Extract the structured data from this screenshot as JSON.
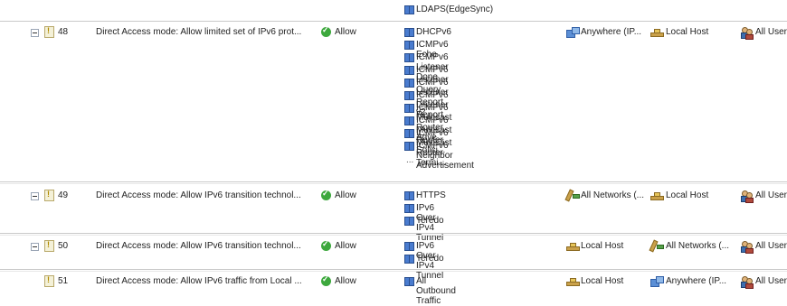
{
  "top_partial": {
    "label": "LDAPS(EdgeSync)"
  },
  "rows": [
    {
      "number": "48",
      "name": "Direct Access mode: Allow limited set of IPv6 prot...",
      "action": "Allow",
      "protocols": [
        "DHCPv6",
        "ICMPv6 Echo",
        "ICMPv6 Listener Done",
        "ICMPv6 Listener Query",
        "ICMPv6 Listener Report v2",
        "ICMPv6 Listener Report",
        "ICMPv6 Multicast Router Adve...",
        "ICMPv6 Multicast Router Solici...",
        "ICMPv6 Multicast Router Termi...",
        "ICMPv6 Neighbor Advertisement"
      ],
      "more": "...",
      "from": "Anywhere (IP...",
      "to": "Local Host",
      "users": "All User"
    },
    {
      "number": "49",
      "name": "Direct Access mode: Allow IPv6 transition technol...",
      "action": "Allow",
      "protocols": [
        "HTTPS",
        "IPv6 Over IPv4 Tunnel",
        "Teredo"
      ],
      "from": "All Networks (...",
      "to": "Local Host",
      "users": "All User"
    },
    {
      "number": "50",
      "name": "Direct Access mode: Allow IPv6 transition technol...",
      "action": "Allow",
      "protocols": [
        "IPv6 Over IPv4 Tunnel",
        "Teredo"
      ],
      "from": "Local Host",
      "to": "All Networks (...",
      "users": "All User"
    },
    {
      "number": "51",
      "name": "Direct Access mode: Allow IPv6 traffic from Local ...",
      "action": "Allow",
      "protocols": [
        "All Outbound Traffic"
      ],
      "from": "Local Host",
      "to": "Anywhere (IP...",
      "users": "All User"
    }
  ],
  "icons": {
    "expander": "collapse-minus-icon",
    "rule": "firewall-rule-icon",
    "allow": "allow-check-icon",
    "protocol": "protocol-icon",
    "network": "network-icon",
    "local_host": "local-host-icon",
    "all_networks": "all-networks-icon",
    "users": "users-icon"
  },
  "colors": {
    "allow_green": "#3da83d",
    "protocol_blue": "#4a7ccf"
  }
}
